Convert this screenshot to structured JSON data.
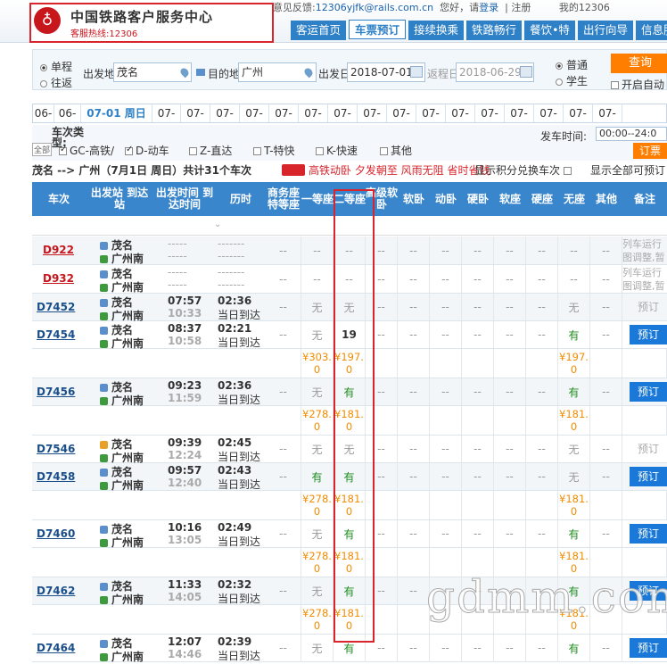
{
  "header": {
    "logo_text": "中国铁路客户服务中心",
    "hotline": "客服热线:12306",
    "feedback_label": "意见反馈:",
    "feedback_email": "12306yjfk@rails.com.cn",
    "greeting": "您好，请",
    "login": "登录",
    "sep": "|",
    "register": "注册",
    "my12306": "我的12306"
  },
  "nav": [
    "客运首页",
    "车票预订",
    "接续换乘",
    "铁路畅行",
    "餐饮•特",
    "出行向导",
    "信息服"
  ],
  "query": {
    "oneway": "单程",
    "round": "往返",
    "from_label": "出发地",
    "from_value": "茂名",
    "to_label": "目的地",
    "to_value": "广州",
    "date_label": "出发日",
    "date_value": "2018-07-01",
    "return_label": "返程日",
    "return_value": "2018-06-29",
    "normal": "普通",
    "student": "学生",
    "query_btn": "查询",
    "auto": "开启自动"
  },
  "dates": [
    "06-",
    "06-",
    "07-01 周日",
    "07-",
    "07-",
    "07-",
    "07-",
    "07-",
    "07-",
    "07-",
    "07-",
    "07-",
    "07-",
    "07-",
    "07-",
    "07-",
    "07-",
    "07-",
    "07-"
  ],
  "filters": {
    "type_label": "车次类型:",
    "all": "全部",
    "gc": "GC-高铁/",
    "d": "D-动车",
    "z": "Z-直达",
    "t": "T-特快",
    "k": "K-快速",
    "other": "其他",
    "depart_label": "发车时间:",
    "depart_value": "00:00--24:0",
    "ticket_book": "订票"
  },
  "route": {
    "text": "茂名 --> 广州（7月1日  周日）共计31个车次",
    "promo": "高铁动卧 夕发朝至 风雨无阻 省时省钱",
    "points": "显示积分兑换车次",
    "all_bookable": "显示全部可预订"
  },
  "columns": [
    "车次",
    "出发站 到达站",
    "出发时间 到达时间",
    "历时",
    "商务座 特等座",
    "一等座",
    "二等座",
    "高级软卧",
    "软卧",
    "动卧",
    "硬卧",
    "软座",
    "硬座",
    "无座",
    "其他",
    "备注"
  ],
  "trains": [
    {
      "no": "D922",
      "from": "茂名",
      "to": "广州南",
      "dep": "-----",
      "arr": "-----",
      "dur": "-------",
      "day": "-------",
      "seats": [
        "--",
        "--",
        "--",
        "--",
        "--",
        "--",
        "--",
        "--",
        "--",
        "--",
        "--"
      ],
      "note": "列车运行图调整,暂停发售",
      "red": true
    },
    {
      "no": "D932",
      "from": "茂名",
      "to": "广州南",
      "dep": "-----",
      "arr": "-----",
      "dur": "-------",
      "day": "-------",
      "seats": [
        "--",
        "--",
        "--",
        "--",
        "--",
        "--",
        "--",
        "--",
        "--",
        "--",
        "--"
      ],
      "note": "列车运行图调整,暂停发售",
      "red": true
    },
    {
      "no": "D7452",
      "from": "茂名",
      "to": "广州南",
      "dep": "07:57",
      "arr": "10:33",
      "dur": "02:36",
      "day": "当日到达",
      "seats": [
        "--",
        "无",
        "无",
        "--",
        "--",
        "--",
        "--",
        "--",
        "--",
        "无",
        "--"
      ],
      "note": "预订"
    },
    {
      "no": "D7454",
      "from": "茂名",
      "to": "广州南",
      "dep": "08:37",
      "arr": "10:58",
      "dur": "02:21",
      "day": "当日到达",
      "seats": [
        "--",
        "无",
        "19",
        "--",
        "--",
        "--",
        "--",
        "--",
        "--",
        "有",
        "--"
      ],
      "note": "预订",
      "prices": [
        "¥303.0",
        "¥197.0",
        "¥197.0"
      ]
    },
    {
      "no": "D7456",
      "from": "茂名",
      "to": "广州南",
      "dep": "09:23",
      "arr": "11:59",
      "dur": "02:36",
      "day": "当日到达",
      "seats": [
        "--",
        "无",
        "有",
        "--",
        "--",
        "--",
        "--",
        "--",
        "--",
        "有",
        "--"
      ],
      "note": "预订",
      "prices": [
        "¥278.0",
        "¥181.0",
        "¥181.0"
      ]
    },
    {
      "no": "D7546",
      "from": "茂名",
      "to": "广州南",
      "dep": "09:39",
      "arr": "12:24",
      "dur": "02:45",
      "day": "当日到达",
      "seats": [
        "--",
        "无",
        "无",
        "--",
        "--",
        "--",
        "--",
        "--",
        "--",
        "无",
        "--"
      ],
      "note": "预订"
    },
    {
      "no": "D7458",
      "from": "茂名",
      "to": "广州南",
      "dep": "09:57",
      "arr": "12:40",
      "dur": "02:43",
      "day": "当日到达",
      "seats": [
        "--",
        "有",
        "有",
        "--",
        "--",
        "--",
        "--",
        "--",
        "--",
        "无",
        "--"
      ],
      "note": "预订",
      "prices": [
        "¥278.0",
        "¥181.0",
        "¥181.0"
      ]
    },
    {
      "no": "D7460",
      "from": "茂名",
      "to": "广州南",
      "dep": "10:16",
      "arr": "13:05",
      "dur": "02:49",
      "day": "当日到达",
      "seats": [
        "--",
        "无",
        "有",
        "--",
        "--",
        "--",
        "--",
        "--",
        "--",
        "有",
        "--"
      ],
      "note": "预订",
      "prices": [
        "¥278.0",
        "¥181.0",
        "¥181.0"
      ]
    },
    {
      "no": "D7462",
      "from": "茂名",
      "to": "广州南",
      "dep": "11:33",
      "arr": "14:05",
      "dur": "02:32",
      "day": "当日到达",
      "seats": [
        "--",
        "无",
        "有",
        "--",
        "--",
        "--",
        "--",
        "--",
        "--",
        "有",
        "--"
      ],
      "note": "预订",
      "prices": [
        "¥278.0",
        "¥181.0",
        "¥181.0"
      ]
    },
    {
      "no": "D7464",
      "from": "茂名",
      "to": "广州南",
      "dep": "12:07",
      "arr": "14:46",
      "dur": "02:39",
      "day": "当日到达",
      "seats": [
        "--",
        "无",
        "有",
        "--",
        "--",
        "--",
        "--",
        "--",
        "--",
        "有",
        "--"
      ],
      "note": "预订"
    }
  ],
  "watermark": "gdmm.com"
}
